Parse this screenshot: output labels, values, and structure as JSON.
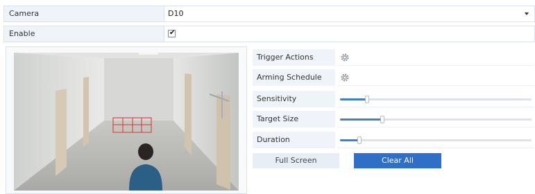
{
  "form": {
    "camera_label": "Camera",
    "camera_value": "D10",
    "enable_label": "Enable",
    "enable_checked": true,
    "enable_check_glyph": "✔"
  },
  "properties": {
    "trigger_actions_label": "Trigger Actions",
    "arming_schedule_label": "Arming Schedule",
    "sensitivity_label": "Sensitivity",
    "sensitivity_level": 0.14,
    "target_size_label": "Target Size",
    "target_size_level": 0.22,
    "duration_label": "Duration",
    "duration_level": 0.1
  },
  "buttons": {
    "full_screen_label": "Full Screen",
    "clear_all_label": "Clear All"
  },
  "colors": {
    "accent": "#2f6fc8",
    "label_bg": "#eef4fa",
    "detection_grid": "#d9302a"
  },
  "icons": {
    "trigger_actions": "gear-icon",
    "arming_schedule": "gear-icon",
    "camera_dropdown": "chevron-down-icon"
  }
}
